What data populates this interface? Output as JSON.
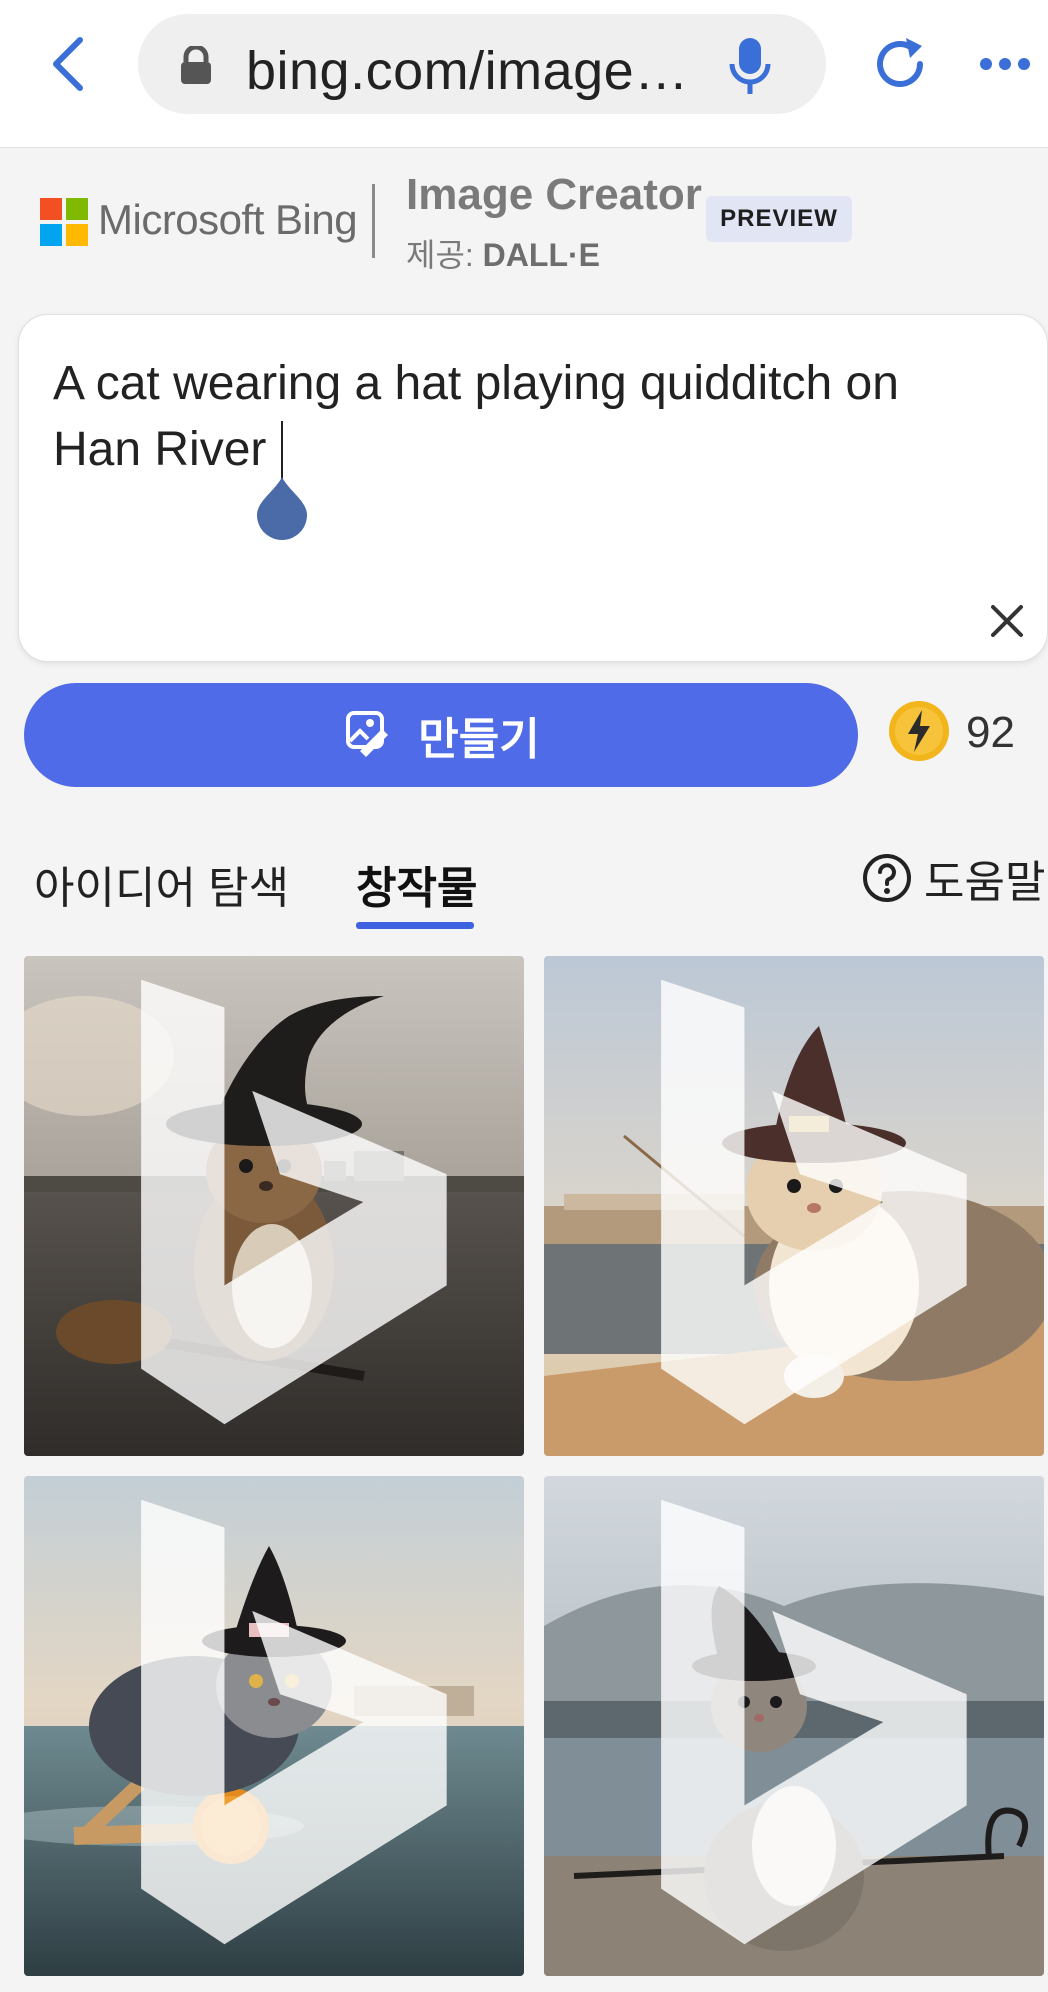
{
  "browser": {
    "url": "bing.com/image…",
    "icons": [
      "back-icon",
      "lock-icon",
      "microphone-icon",
      "reload-icon",
      "more-icon"
    ],
    "accent": "#3b6fd8"
  },
  "brand": {
    "name": "Microsoft Bing",
    "product": "Image Creator",
    "provider_prefix": "제공:",
    "provider": "DALL·E",
    "badge": "PREVIEW"
  },
  "prompt": {
    "text": "A cat wearing a hat playing quidditch on Han River"
  },
  "create": {
    "label": "만들기",
    "boost_count": "92",
    "button_color": "#4f6be8"
  },
  "tabs": {
    "explore": "아이디어 탐색",
    "creations": "창작물",
    "active": "창작물",
    "help": "도움말"
  },
  "images": [
    {
      "subject": "cat with witch hat riding broom over river"
    },
    {
      "subject": "cat with witch hat on riverbank holding stick"
    },
    {
      "subject": "grey cat in witch hat on broom with orange ball"
    },
    {
      "subject": "tabby cat in witch hat holding staff on shore"
    }
  ]
}
